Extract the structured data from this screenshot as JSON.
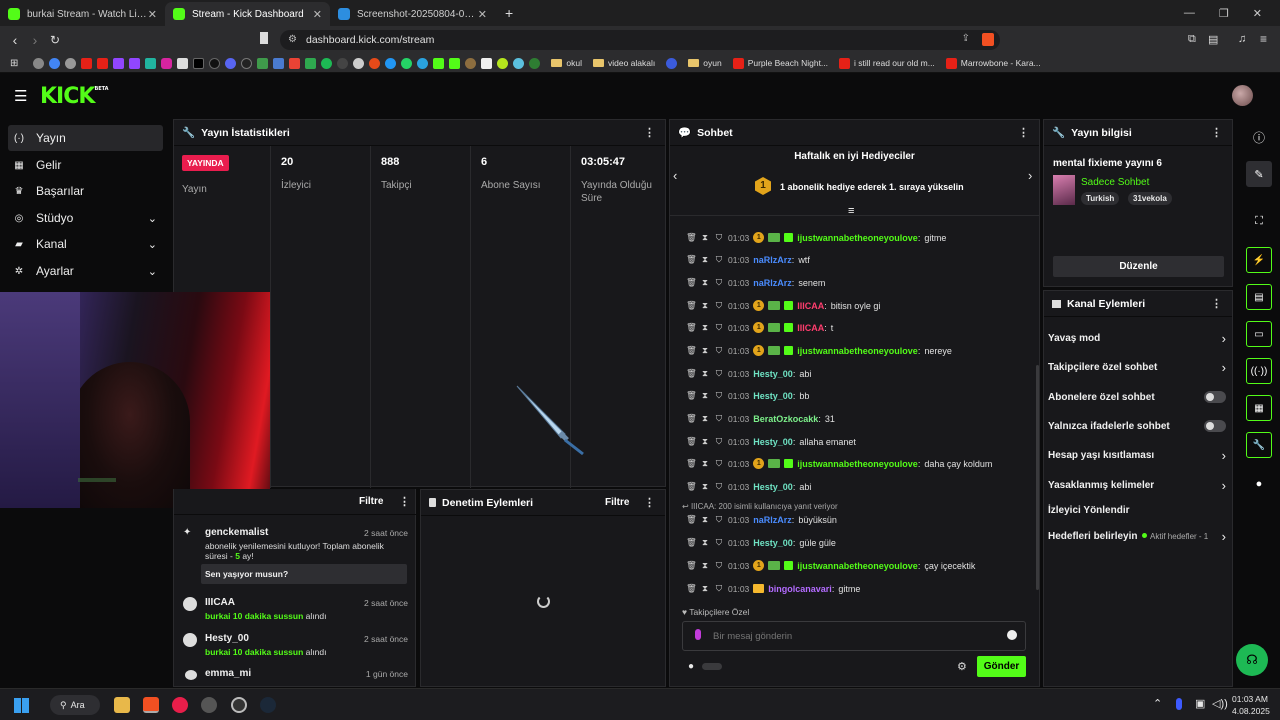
{
  "browser": {
    "tabs": [
      {
        "title": "burkai Stream - Watch Live on Kick",
        "active": false
      },
      {
        "title": "Stream - Kick Dashboard",
        "active": true
      },
      {
        "title": "Screenshot-20250804-010111 hoste",
        "active": false
      }
    ],
    "new_tab": "+",
    "url": "dashboard.kick.com/stream",
    "bookmarks": [
      {
        "label": "okul"
      },
      {
        "label": "video alakalı"
      },
      {
        "label": "oyun"
      },
      {
        "label": "Purple Beach Night..."
      },
      {
        "label": "i still read our old m..."
      },
      {
        "label": "Marrowbone - Kara..."
      }
    ]
  },
  "header": {
    "logo": "KICK",
    "logo_beta": "BETA"
  },
  "sidebar": {
    "items": [
      {
        "label": "Yayın",
        "icon": "(·)"
      },
      {
        "label": "Gelir",
        "icon": "▦"
      },
      {
        "label": "Başarılar",
        "icon": "♛"
      },
      {
        "label": "Stüdyo",
        "icon": "◎"
      },
      {
        "label": "Kanal",
        "icon": "▰"
      },
      {
        "label": "Ayarlar",
        "icon": "✲"
      }
    ]
  },
  "stats": {
    "title": "Yayın İstatistikleri",
    "live_badge": "YAYINDA",
    "live_label": "Yayın",
    "cols": [
      {
        "value": "20",
        "label": "İzleyici"
      },
      {
        "value": "888",
        "label": "Takipçi"
      },
      {
        "value": "6",
        "label": "Abone Sayısı"
      },
      {
        "value": "03:05:47",
        "label": "Yayında Olduğu Süre"
      }
    ]
  },
  "activity": {
    "filter": "Filtre",
    "items": [
      {
        "name": "genckemalist",
        "time": "2 saat önce",
        "line1": "abonelik yenilemesini kutluyor! Toplam abonelik",
        "line2": "süresi - ",
        "line2_highlight": "5",
        "line2_end": " ay!",
        "message": "Sen yaşıyor musun?"
      },
      {
        "name": "IIICAA",
        "time": "2 saat önce",
        "action_user": "burkai",
        "action": "10 dakika sussun",
        "action_end": " alındı"
      },
      {
        "name": "Hesty_00",
        "time": "2 saat önce",
        "action_user": "burkai",
        "action": "10 dakika sussun",
        "action_end": " alındı"
      },
      {
        "name": "emma_mi",
        "time": "1 gün önce"
      }
    ]
  },
  "moderation": {
    "title": "Denetim Eylemleri",
    "filter": "Filtre"
  },
  "chat": {
    "title": "Sohbet",
    "gifters_title": "Haftalık en iyi Hediyeciler",
    "gifters_rank": "1",
    "gifters_text": "1 abonelik hediye ederek 1. sıraya yükselin",
    "messages": [
      {
        "time": "01:03",
        "badges": "cg",
        "user": "ijustwannabetheoneyoulove",
        "color": "#53fc18",
        "text": "gitme"
      },
      {
        "time": "01:03",
        "badges": "",
        "user": "naRlzArz",
        "color": "#4a8cff",
        "text": "wtf"
      },
      {
        "time": "01:03",
        "badges": "",
        "user": "naRlzArz",
        "color": "#4a8cff",
        "text": "senem"
      },
      {
        "time": "01:03",
        "badges": "cg",
        "user": "IIICAA",
        "color": "#ff3d6e",
        "text": "bitisn oyle gi"
      },
      {
        "time": "01:03",
        "badges": "cg",
        "user": "IIICAA",
        "color": "#ff3d6e",
        "text": "t"
      },
      {
        "time": "01:03",
        "badges": "cg",
        "user": "ijustwannabetheoneyoulove",
        "color": "#53fc18",
        "text": "nereye"
      },
      {
        "time": "01:03",
        "badges": "",
        "user": "Hesty_00",
        "color": "#6fe3c4",
        "text": "abi"
      },
      {
        "time": "01:03",
        "badges": "",
        "user": "Hesty_00",
        "color": "#6fe3c4",
        "text": "bb"
      },
      {
        "time": "01:03",
        "badges": "",
        "user": "BeratOzkocakk",
        "color": "#7cf08a",
        "text": "31"
      },
      {
        "time": "01:03",
        "badges": "",
        "user": "Hesty_00",
        "color": "#6fe3c4",
        "text": "allaha emanet"
      },
      {
        "time": "01:03",
        "badges": "cg",
        "user": "ijustwannabetheoneyoulove",
        "color": "#53fc18",
        "text": "daha çay koldum"
      },
      {
        "time": "01:03",
        "badges": "",
        "user": "Hesty_00",
        "color": "#6fe3c4",
        "text": "abi"
      },
      {
        "time": "01:03",
        "badges": "",
        "user": "naRlzArz",
        "color": "#4a8cff",
        "text": "büyüksün"
      },
      {
        "time": "01:03",
        "badges": "",
        "user": "Hesty_00",
        "color": "#6fe3c4",
        "text": "güle güle"
      },
      {
        "time": "01:03",
        "badges": "cg",
        "user": "ijustwannabetheoneyoulove",
        "color": "#53fc18",
        "text": "çay içecektik"
      },
      {
        "time": "01:03",
        "badges": "k",
        "user": "bingolcanavari",
        "color": "#b36bff",
        "text": "gitme"
      }
    ],
    "reply_note": "IIICAA: 200 isimli kullanıcıya yanıt veriyor",
    "followers_only": "Takipçilere Özel",
    "input_placeholder": "Bir mesaj gönderin",
    "send": "Gönder"
  },
  "stream_info": {
    "title": "Yayın bilgisi",
    "stream_title": "mental fixieme yayını 6",
    "category": "Sadece Sohbet",
    "tags": [
      "Turkish",
      "31vekola"
    ],
    "edit": "Düzenle"
  },
  "channel_actions": {
    "title": "Kanal Eylemleri",
    "items": [
      {
        "label": "Yavaş mod",
        "kind": "chevron"
      },
      {
        "label": "Takipçilere özel sohbet",
        "kind": "chevron"
      },
      {
        "label": "Abonelere özel sohbet",
        "kind": "toggle"
      },
      {
        "label": "Yalnızca ifadelerle sohbet",
        "kind": "toggle"
      },
      {
        "label": "Hesap yaşı kısıtlaması",
        "kind": "chevron"
      },
      {
        "label": "Yasaklanmış kelimeler",
        "kind": "chevron"
      },
      {
        "label": "İzleyici Yönlendir",
        "kind": "none"
      },
      {
        "label": "Hedefleri belirleyin",
        "kind": "chevron",
        "extra": "Aktif hedefler - 1"
      }
    ]
  },
  "taskbar": {
    "search": "Ara",
    "time": "01:03 AM",
    "date": "4.08.2025"
  },
  "colors": {
    "accent": "#53fc18",
    "live": "#e91d4e",
    "panel": "#18181b",
    "bg": "#0b0b0c"
  }
}
